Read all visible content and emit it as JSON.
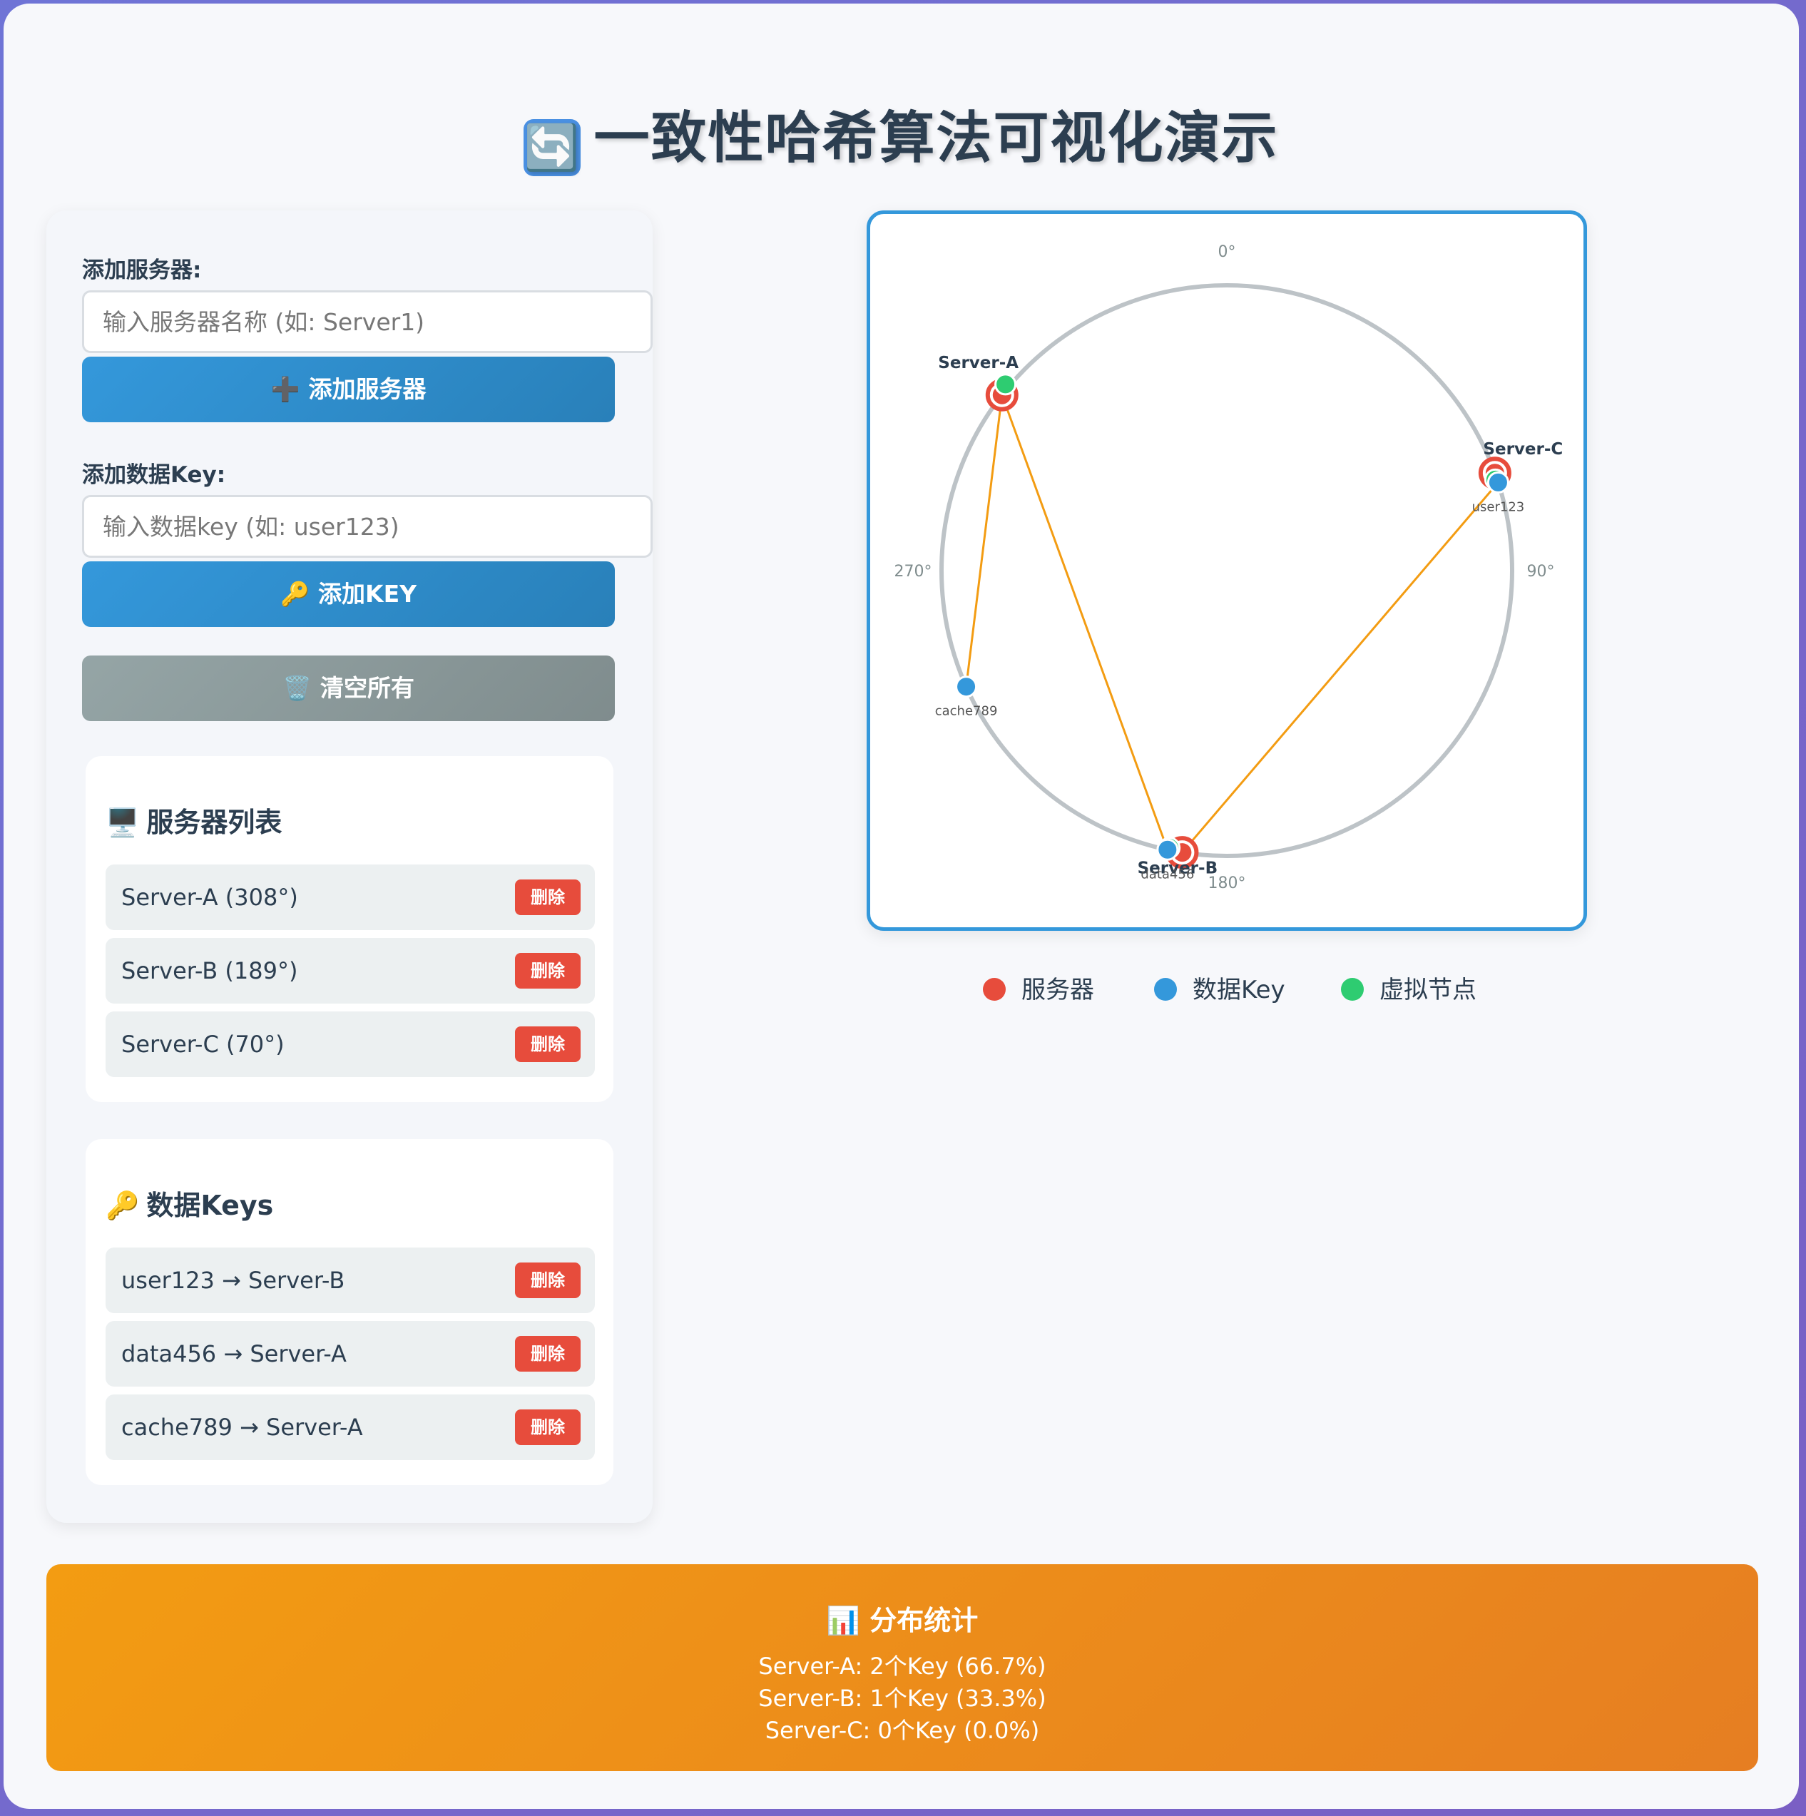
{
  "header": {
    "title_icon": "🔄",
    "title": "一致性哈希算法可视化演示"
  },
  "controls": {
    "server_label": "添加服务器:",
    "server_placeholder": "输入服务器名称 (如: Server1)",
    "add_server_icon": "➕",
    "add_server_button": "添加服务器",
    "key_label": "添加数据Key:",
    "key_placeholder": "输入数据key (如: user123)",
    "add_key_icon": "🔑",
    "add_key_button": "添加KEY",
    "clear_icon": "🗑️",
    "clear_button": "清空所有"
  },
  "servers": {
    "icon": "🖥️",
    "title": "服务器列表",
    "delete_label": "删除",
    "items": [
      {
        "text": "Server-A (308°)"
      },
      {
        "text": "Server-B (189°)"
      },
      {
        "text": "Server-C (70°)"
      }
    ]
  },
  "keys": {
    "icon": "🔑",
    "title": "数据Keys",
    "delete_label": "删除",
    "items": [
      {
        "text": "user123 → Server-B"
      },
      {
        "text": "data456 → Server-A"
      },
      {
        "text": "cache789 → Server-A"
      }
    ]
  },
  "ring": {
    "angle_labels": {
      "top": "0°",
      "right": "90°",
      "bottom": "180°",
      "left": "270°"
    },
    "servers": [
      {
        "name": "Server-A",
        "angle": 308
      },
      {
        "name": "Server-B",
        "angle": 189
      },
      {
        "name": "Server-C",
        "angle": 70
      }
    ],
    "keys": [
      {
        "name": "user123",
        "angle": 72,
        "target": "Server-B"
      },
      {
        "name": "data456",
        "angle": 192,
        "target": "Server-A"
      },
      {
        "name": "cache789",
        "angle": 246,
        "target": "Server-A"
      }
    ],
    "colors": {
      "server": "#e74c3c",
      "key": "#3498db",
      "virtual": "#2ecc71",
      "line": "#f39c12",
      "ring": "#bdc3c7"
    }
  },
  "legend": {
    "server": "服务器",
    "key": "数据Key",
    "virtual": "虚拟节点"
  },
  "stats": {
    "icon": "📊",
    "title": "分布统计",
    "lines": [
      "Server-A: 2个Key (66.7%)",
      "Server-B: 1个Key (33.3%)",
      "Server-C: 0个Key (0.0%)"
    ]
  }
}
